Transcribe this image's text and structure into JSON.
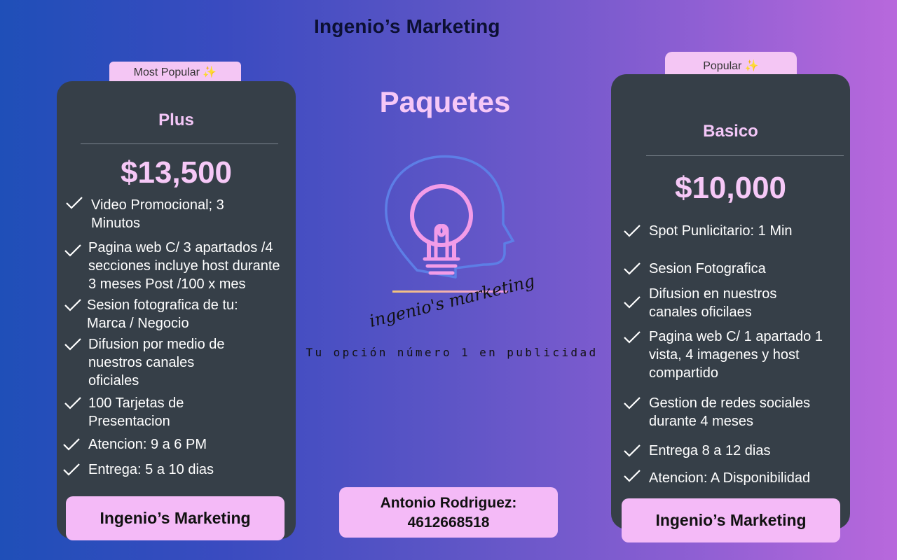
{
  "header": {
    "title": "Ingenio’s Marketing"
  },
  "center": {
    "title": "Paquetes",
    "logo_script": "ingenio's marketing",
    "tagline": "Tu opción número 1 en publicidad",
    "contact": {
      "name": "Antonio Rodriguez:",
      "phone": "4612668518"
    }
  },
  "plan_plus": {
    "badge": "Most Popular ✨",
    "name": "Plus",
    "price": "$13,500",
    "features": [
      [
        "Video Promocional; 3",
        "Minutos"
      ],
      [
        "Pagina web C/ 3 apartados /4",
        "secciones incluye host durante",
        "3 meses Post /100 x mes"
      ],
      [
        "Sesion fotografica de tu:",
        "Marca / Negocio"
      ],
      [
        "Difusion por medio de",
        "nuestros canales",
        "oficiales"
      ],
      [
        "100 Tarjetas de",
        "Presentacion"
      ],
      [
        "Atencion: 9 a 6 PM"
      ],
      [
        "Entrega: 5 a 10 dias"
      ]
    ],
    "button": "Ingenio’s Marketing"
  },
  "plan_basico": {
    "badge": "Popular ✨",
    "name": "Basico",
    "price": "$10,000",
    "features": [
      [
        "Spot Punlicitario: 1 Min"
      ],
      [
        "Sesion Fotografica"
      ],
      [
        "Difusion en nuestros",
        "canales oficilaes"
      ],
      [
        "Pagina web C/ 1 apartado 1",
        "vista, 4 imagenes y host",
        "compartido"
      ],
      [
        "Gestion de redes sociales",
        "durante 4 meses"
      ],
      [
        "Entrega 8 a 12 dias"
      ],
      [
        "Atencion: A Disponibilidad"
      ]
    ],
    "button": "Ingenio’s Marketing"
  },
  "colors": {
    "card_bg": "#363f48",
    "accent_pink": "#f4baf7",
    "title_dark": "#0c1033",
    "gradient_left": "#1f4fb8",
    "gradient_right": "#b868dc"
  },
  "icons": [
    "check-icon",
    "lightbulb-head-icon"
  ]
}
